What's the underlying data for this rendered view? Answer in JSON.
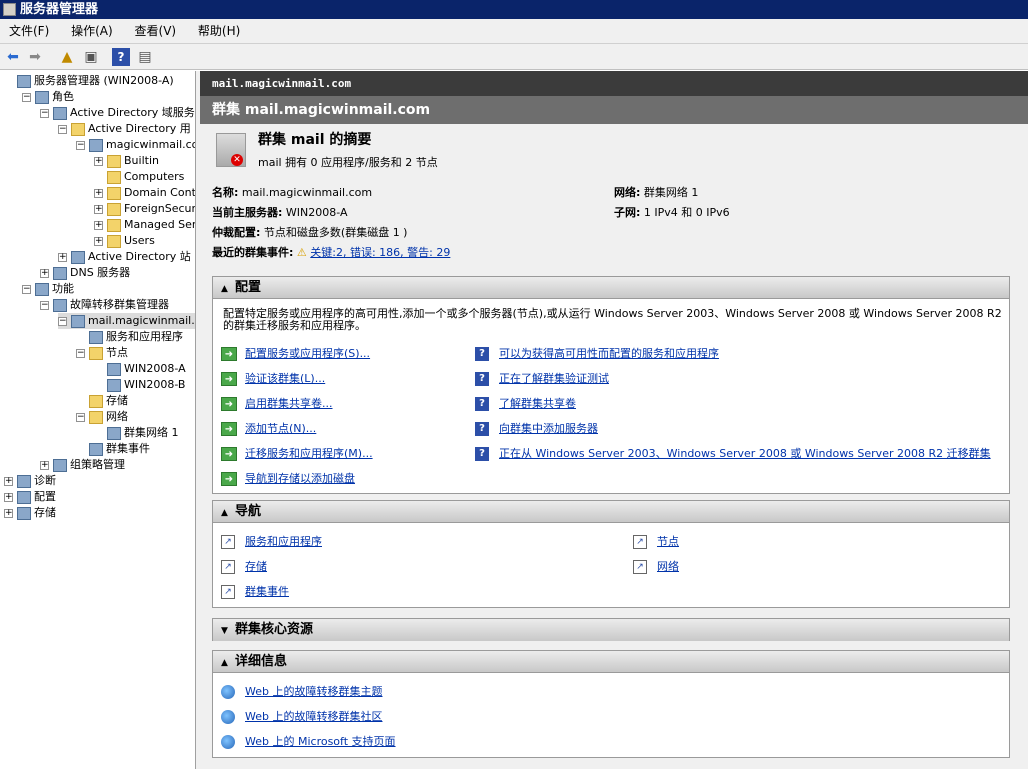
{
  "window": {
    "title": "服务器管理器"
  },
  "menu": [
    "文件(F)",
    "操作(A)",
    "查看(V)",
    "帮助(H)"
  ],
  "tree": [
    {
      "label": "服务器管理器 (WIN2008-A)",
      "indent": 0,
      "box": "",
      "icon": "server-manager"
    },
    {
      "label": "角色",
      "indent": 1,
      "box": "−",
      "icon": "roles"
    },
    {
      "label": "Active Directory 域服务",
      "indent": 2,
      "box": "−",
      "icon": "ad"
    },
    {
      "label": "Active Directory 用",
      "indent": 3,
      "box": "−",
      "icon": "folder"
    },
    {
      "label": "magicwinmail.com",
      "indent": 4,
      "box": "−",
      "icon": "domain"
    },
    {
      "label": "Builtin",
      "indent": 5,
      "box": "+",
      "icon": "folder"
    },
    {
      "label": "Computers",
      "indent": 5,
      "box": "",
      "icon": "folder"
    },
    {
      "label": "Domain Contr",
      "indent": 5,
      "box": "+",
      "icon": "folder"
    },
    {
      "label": "ForeignSecur",
      "indent": 5,
      "box": "+",
      "icon": "folder"
    },
    {
      "label": "Managed Serv",
      "indent": 5,
      "box": "+",
      "icon": "folder"
    },
    {
      "label": "Users",
      "indent": 5,
      "box": "+",
      "icon": "folder"
    },
    {
      "label": "Active Directory 站",
      "indent": 3,
      "box": "+",
      "icon": "ad"
    },
    {
      "label": "DNS 服务器",
      "indent": 2,
      "box": "+",
      "icon": "dns"
    },
    {
      "label": "功能",
      "indent": 1,
      "box": "−",
      "icon": "features"
    },
    {
      "label": "故障转移群集管理器",
      "indent": 2,
      "box": "−",
      "icon": "cluster"
    },
    {
      "label": "mail.magicwinmail.c",
      "indent": 3,
      "box": "−",
      "icon": "cluster",
      "selected": true
    },
    {
      "label": "服务和应用程序",
      "indent": 4,
      "box": "",
      "icon": "services"
    },
    {
      "label": "节点",
      "indent": 4,
      "box": "−",
      "icon": "folder"
    },
    {
      "label": "WIN2008-A",
      "indent": 5,
      "box": "",
      "icon": "node"
    },
    {
      "label": "WIN2008-B",
      "indent": 5,
      "box": "",
      "icon": "node"
    },
    {
      "label": "存储",
      "indent": 4,
      "box": "",
      "icon": "folder"
    },
    {
      "label": "网络",
      "indent": 4,
      "box": "−",
      "icon": "folder"
    },
    {
      "label": "群集网络 1",
      "indent": 5,
      "box": "",
      "icon": "network"
    },
    {
      "label": "群集事件",
      "indent": 4,
      "box": "",
      "icon": "events"
    },
    {
      "label": "组策略管理",
      "indent": 2,
      "box": "+",
      "icon": "gpo"
    },
    {
      "label": "诊断",
      "indent": 0,
      "box": "+",
      "icon": "diag"
    },
    {
      "label": "配置",
      "indent": 0,
      "box": "+",
      "icon": "config"
    },
    {
      "label": "存储",
      "indent": 0,
      "box": "+",
      "icon": "storage"
    }
  ],
  "right": {
    "header": "mail.magicwinmail.com",
    "title": "群集 mail.magicwinmail.com",
    "summary_title": "群集 mail 的摘要",
    "summary_sub": "mail 拥有 0 应用程序/服务和 2 节点",
    "name_label": "名称:",
    "name_value": " mail.magicwinmail.com",
    "host_label": "当前主服务器:",
    "host_value": " WIN2008-A",
    "quorum_label": "仲裁配置:",
    "quorum_value": " 节点和磁盘多数(群集磁盘 1 )",
    "events_label": "最近的群集事件:",
    "events_value": "关键:2, 错误: 186, 警告: 29",
    "net_label": "网络:",
    "net_value": " 群集网络 1",
    "subnet_label": "子网:",
    "subnet_value": " 1 IPv4 和 0 IPv6"
  },
  "config": {
    "title": "配置",
    "desc": "配置特定服务或应用程序的高可用性,添加一个或多个服务器(节点),或从运行 Windows Server 2003、Windows Server 2008 或 Windows Server 2008 R2 的群集迁移服务和应用程序。",
    "left": [
      "配置服务或应用程序(S)...",
      "验证该群集(L)...",
      "启用群集共享卷...",
      "添加节点(N)...",
      "迁移服务和应用程序(M)...",
      "导航到存储以添加磁盘"
    ],
    "right": [
      "可以为获得高可用性而配置的服务和应用程序",
      "正在了解群集验证测试",
      "了解群集共享卷",
      "向群集中添加服务器",
      "正在从 Windows Server 2003、Windows Server 2008 或 Windows Server 2008 R2 迁移群集"
    ]
  },
  "nav": {
    "title": "导航",
    "left": [
      "服务和应用程序",
      "存储",
      "群集事件"
    ],
    "right": [
      "节点",
      "网络"
    ]
  },
  "core": {
    "title": "群集核心资源"
  },
  "details": {
    "title": "详细信息",
    "links": [
      "Web 上的故障转移群集主题",
      "Web 上的故障转移群集社区",
      "Web 上的 Microsoft 支持页面"
    ]
  }
}
